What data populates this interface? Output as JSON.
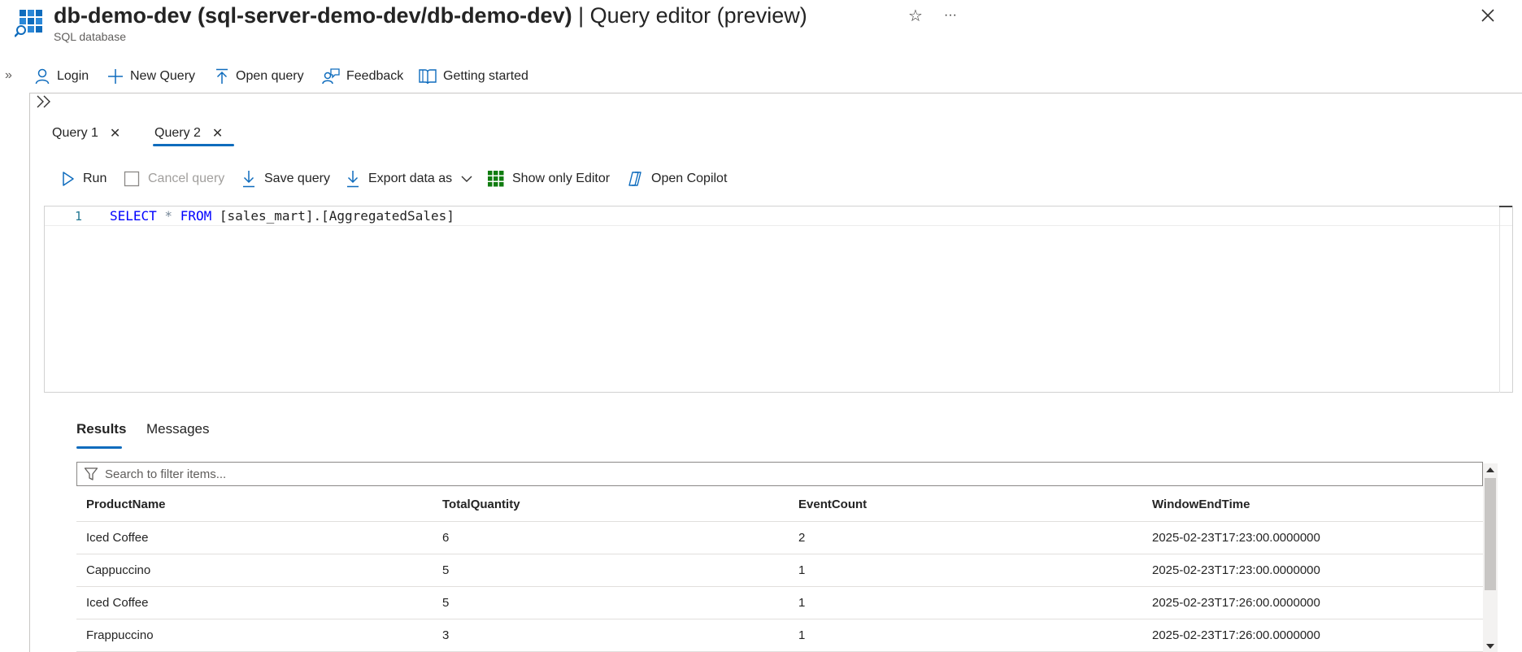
{
  "header": {
    "title_bold": "db-demo-dev (sql-server-demo-dev/db-demo-dev)",
    "title_rest": " | Query editor (preview)",
    "subtitle": "SQL database",
    "star_glyph": "☆",
    "more_glyph": "···"
  },
  "commandbar": {
    "expand_glyph": "»",
    "login": "Login",
    "new_query": "New Query",
    "open_query": "Open query",
    "feedback": "Feedback",
    "getting_started": "Getting started"
  },
  "query_tabs": [
    {
      "label": "Query 1",
      "active": false
    },
    {
      "label": "Query 2",
      "active": true
    }
  ],
  "tab_close_glyph": "✕",
  "editor_toolbar": {
    "run": "Run",
    "cancel_query": "Cancel query",
    "save_query": "Save query",
    "export_data_as": "Export data as",
    "show_only_editor": "Show only Editor",
    "open_copilot": "Open Copilot"
  },
  "editor": {
    "line_number": "1",
    "code": {
      "kw_select": "SELECT",
      "star": " * ",
      "kw_from": "FROM",
      "rest": " [sales_mart].[AggregatedSales]"
    }
  },
  "results": {
    "tabs": [
      "Results",
      "Messages"
    ],
    "filter_placeholder": "Search to filter items...",
    "columns": [
      "ProductName",
      "TotalQuantity",
      "EventCount",
      "WindowEndTime"
    ],
    "rows": [
      [
        "Iced Coffee",
        "6",
        "2",
        "2025-02-23T17:23:00.0000000"
      ],
      [
        "Cappuccino",
        "5",
        "1",
        "2025-02-23T17:23:00.0000000"
      ],
      [
        "Iced Coffee",
        "5",
        "1",
        "2025-02-23T17:26:00.0000000"
      ],
      [
        "Frappuccino",
        "3",
        "1",
        "2025-02-23T17:26:00.0000000"
      ]
    ]
  },
  "colors": {
    "accent": "#0f6cbd",
    "sql_keyword": "#0000ff",
    "icon_blue": "#0f6cbd",
    "grid_icon_green": "#107c10"
  }
}
